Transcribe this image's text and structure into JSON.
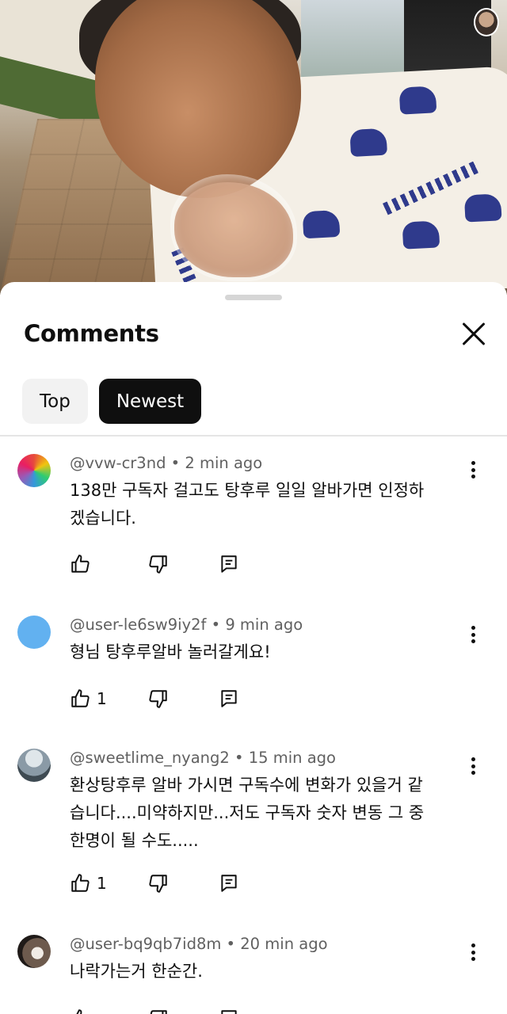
{
  "video": {
    "channel_avatar": "channel-avatar"
  },
  "sheet": {
    "title": "Comments",
    "close_icon": "close-icon",
    "chips": [
      {
        "label": "Top",
        "selected": false
      },
      {
        "label": "Newest",
        "selected": true
      }
    ]
  },
  "comments": [
    {
      "handle": "@vvw-cr3nd",
      "time": "2 min ago",
      "lines": [
        "138만 구독자 걸고도 탕후루 일일 알바가면 인정하",
        "겠습니다."
      ],
      "likes": "",
      "avatar_color": "#c0392b"
    },
    {
      "handle": "@user-le6sw9iy2f",
      "time": "9 min ago",
      "lines": [
        "형님 탕후루알바 놀러갈게요!"
      ],
      "likes": "1",
      "avatar_color": "#62b1f0"
    },
    {
      "handle": "@sweetlime_nyang2",
      "time": "15 min ago",
      "lines": [
        "환상탕후루 알바 가시면 구독수에 변화가 있을거 같",
        "습니다....미약하지만...저도 구독자 숫자 변동 그 중",
        "한명이 될 수도....."
      ],
      "likes": "1",
      "avatar_color": "#8a9aa6"
    },
    {
      "handle": "@user-bq9qb7id8m",
      "time": "20 min ago",
      "lines": [
        "나락가는거 한순간."
      ],
      "likes": "",
      "avatar_color": "#3a2e2a"
    }
  ],
  "icons": [
    "like-icon",
    "dislike-icon",
    "reply-icon",
    "more-vert-icon"
  ],
  "separator": "•"
}
